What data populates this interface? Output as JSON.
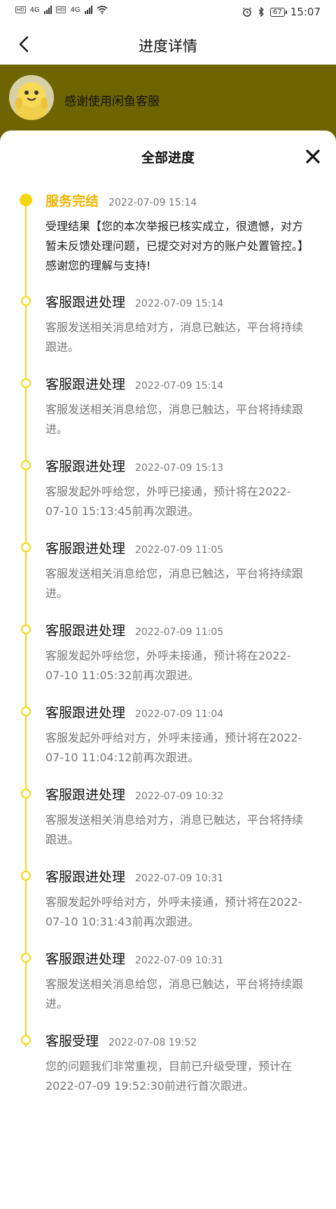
{
  "status_bar": {
    "sim1": "HD",
    "sim2": "HD",
    "net1": "4G",
    "net2": "4G",
    "battery": "67",
    "time": "15:07"
  },
  "nav": {
    "title": "进度详情"
  },
  "banner": {
    "text": "感谢使用闲鱼客服"
  },
  "sheet": {
    "title": "全部进度"
  },
  "colors": {
    "accent": "#f5d70f",
    "done_title": "#f0b400",
    "banner_bg": "#6f6500"
  },
  "entries": [
    {
      "title": "服务完结",
      "time": "2022-07-09 15:14",
      "body": "受理结果【您的本次举报已核实成立，很遗憾，对方暂未反馈处理问题，已提交对对方的账户处置管控。】感谢您的理解与支持!"
    },
    {
      "title": "客服跟进处理",
      "time": "2022-07-09 15:14",
      "body": "客服发送相关消息给对方，消息已触达，平台将持续跟进。"
    },
    {
      "title": "客服跟进处理",
      "time": "2022-07-09 15:14",
      "body": "客服发送相关消息给您，消息已触达，平台将持续跟进。"
    },
    {
      "title": "客服跟进处理",
      "time": "2022-07-09 15:13",
      "body": "客服发起外呼给您，外呼已接通，预计将在2022-07-10 15:13:45前再次跟进。"
    },
    {
      "title": "客服跟进处理",
      "time": "2022-07-09 11:05",
      "body": "客服发送相关消息给您，消息已触达，平台将持续跟进。"
    },
    {
      "title": "客服跟进处理",
      "time": "2022-07-09 11:05",
      "body": "客服发起外呼给您，外呼未接通，预计将在2022-07-10 11:05:32前再次跟进。"
    },
    {
      "title": "客服跟进处理",
      "time": "2022-07-09 11:04",
      "body": "客服发起外呼给对方，外呼未接通，预计将在2022-07-10 11:04:12前再次跟进。"
    },
    {
      "title": "客服跟进处理",
      "time": "2022-07-09 10:32",
      "body": "客服发送相关消息给对方，消息已触达，平台将持续跟进。"
    },
    {
      "title": "客服跟进处理",
      "time": "2022-07-09 10:31",
      "body": "客服发起外呼给对方，外呼未接通，预计将在2022-07-10 10:31:43前再次跟进。"
    },
    {
      "title": "客服跟进处理",
      "time": "2022-07-09 10:31",
      "body": "客服发送相关消息给您，消息已触达，平台将持续跟进。"
    },
    {
      "title": "客服受理",
      "time": "2022-07-08 19:52",
      "body": "您的问题我们非常重视，目前已升级受理，预计在2022-07-09 19:52:30前进行首次跟进。"
    }
  ]
}
